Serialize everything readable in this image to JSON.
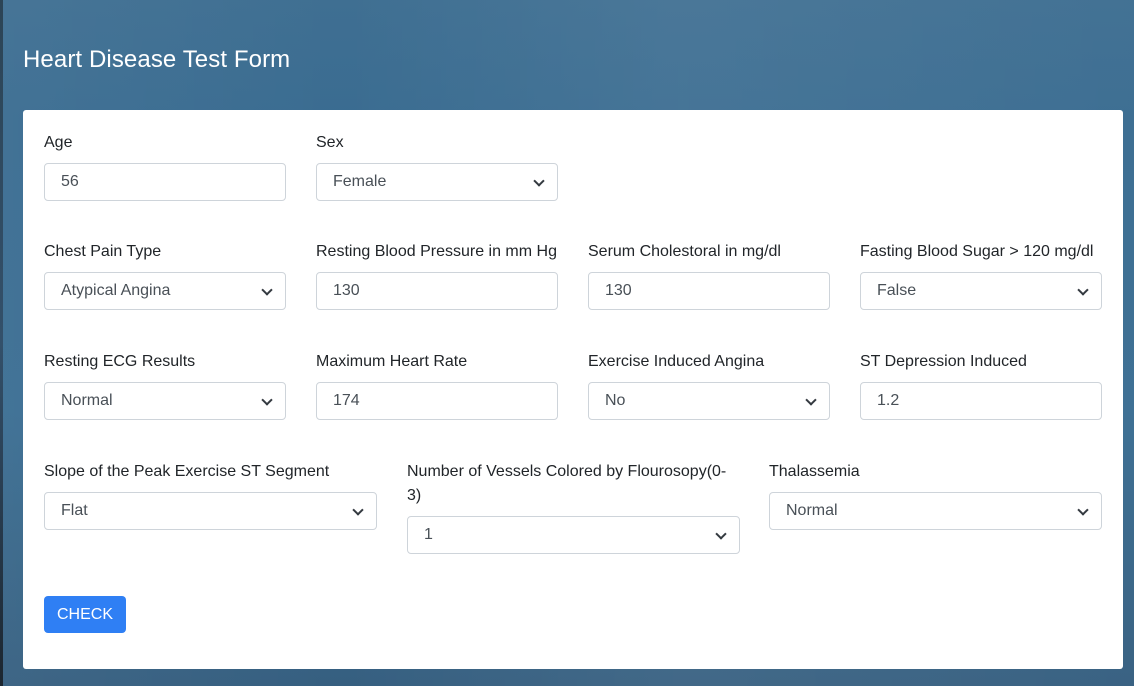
{
  "page": {
    "title": "Heart Disease Test Form"
  },
  "form": {
    "age": {
      "label": "Age",
      "value": "56"
    },
    "sex": {
      "label": "Sex",
      "selected": "Female"
    },
    "chest_pain": {
      "label": "Chest Pain Type",
      "selected": "Atypical Angina"
    },
    "resting_bp": {
      "label": "Resting Blood Pressure in mm Hg",
      "value": "130"
    },
    "cholesterol": {
      "label": "Serum Cholestoral in mg/dl",
      "value": "130"
    },
    "fasting_sugar": {
      "label": "Fasting Blood Sugar > 120 mg/dl",
      "selected": "False"
    },
    "resting_ecg": {
      "label": "Resting ECG Results",
      "selected": "Normal"
    },
    "max_hr": {
      "label": "Maximum Heart Rate",
      "value": "174"
    },
    "exercise_angina": {
      "label": "Exercise Induced Angina",
      "selected": "No"
    },
    "st_depression": {
      "label": "ST Depression Induced",
      "value": "1.2"
    },
    "slope": {
      "label": "Slope of the Peak Exercise ST Segment",
      "selected": "Flat"
    },
    "vessels": {
      "label_line1": "Number of Vessels Colored by Flourosopy(0-",
      "label_line2": "3)",
      "selected": "1"
    },
    "thalassemia": {
      "label": "Thalassemia",
      "selected": "Normal"
    },
    "submit_label": "CHECK"
  }
}
